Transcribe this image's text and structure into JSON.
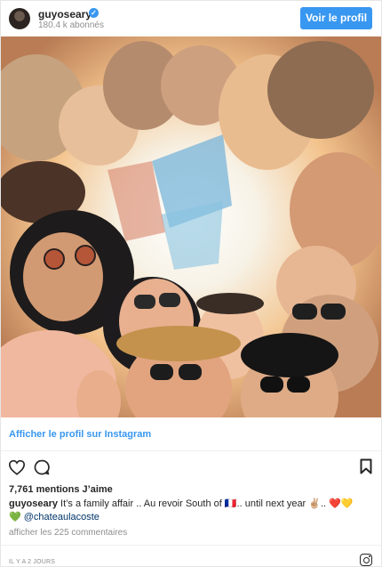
{
  "header": {
    "username": "guyoseary",
    "followers": "180.4 k abonnés",
    "profile_button": "Voir le profil"
  },
  "photo": {
    "description_icon": "group-selfie-photo"
  },
  "link": {
    "view_profile": "Afficher le profil sur Instagram"
  },
  "post": {
    "likes": "7,761 mentions J’aime",
    "caption_user": "guyoseary",
    "caption_text": "It’s a family affair .. Au revoir South of 🇫🇷.. until next year ✌🏼.. ❤️💛",
    "caption_line2_emoji": "💚",
    "mention": "@chateaulacoste",
    "comments": "afficher les 225 commentaires",
    "timestamp": "IL Y A 2 JOURS"
  },
  "colors": {
    "accent": "#3897f0",
    "text": "#262626",
    "muted": "#8e8e8e"
  }
}
